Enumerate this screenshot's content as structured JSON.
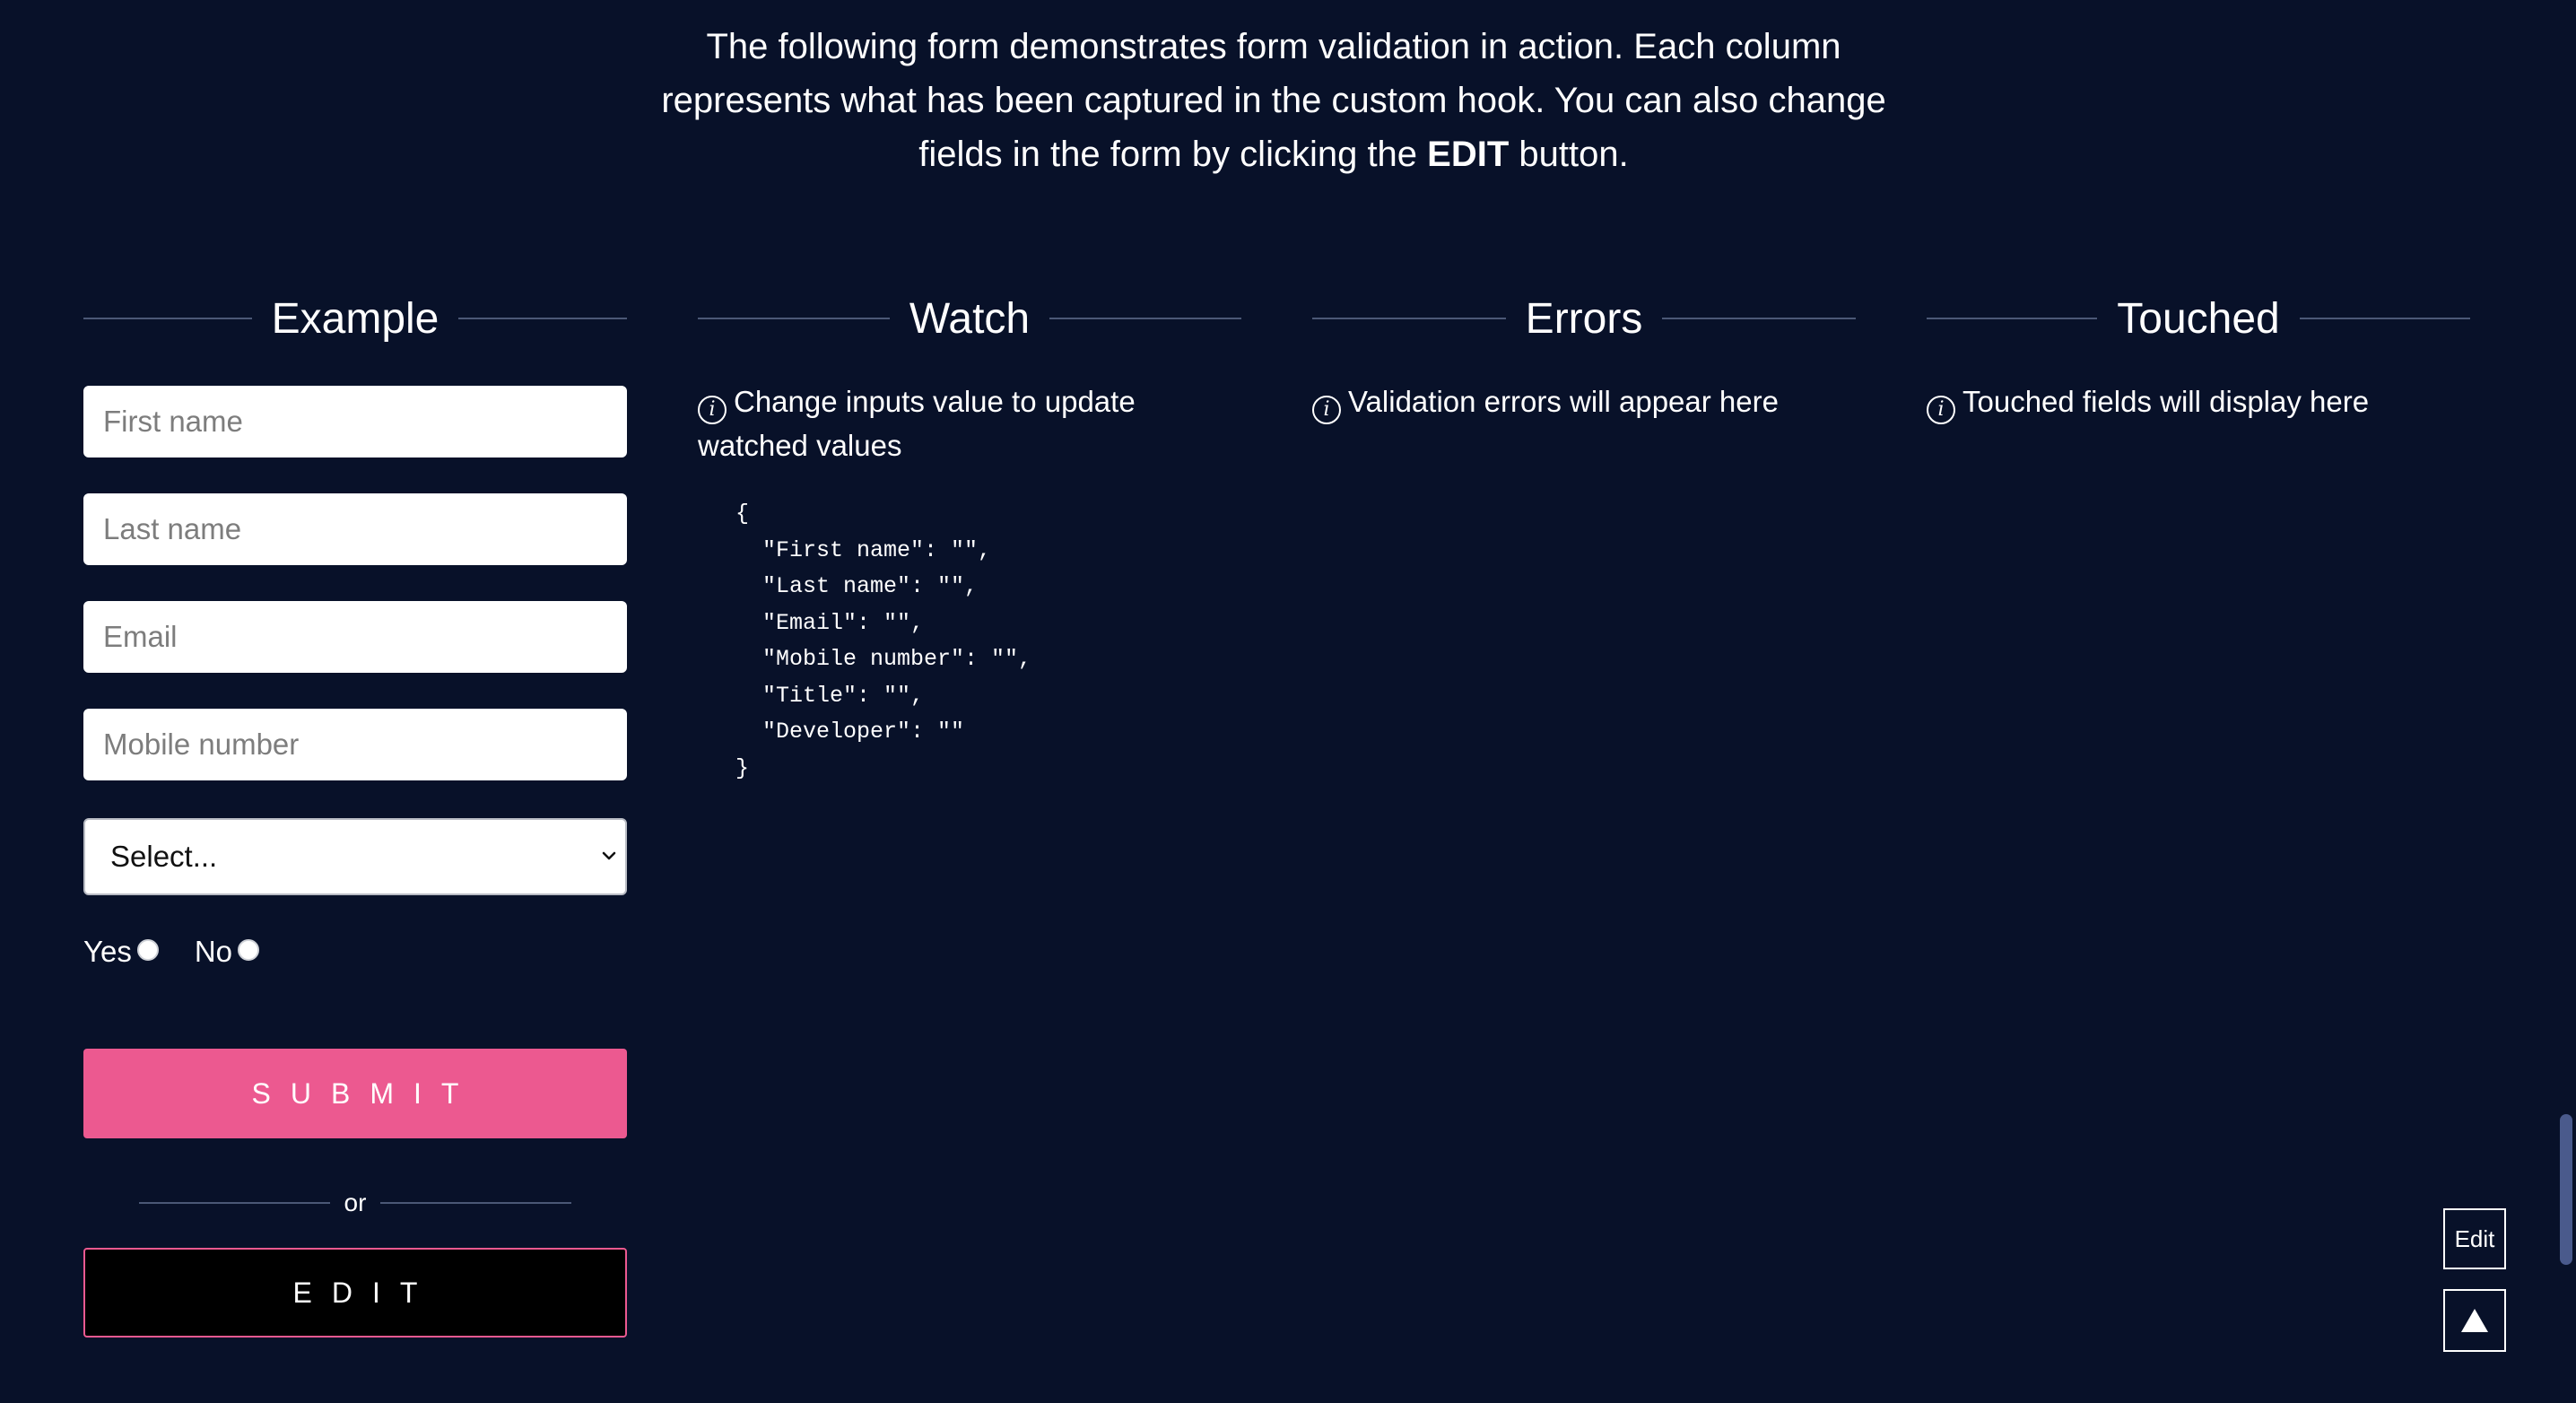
{
  "intro": {
    "line1": "The following form demonstrates form validation in action. Each column",
    "line2": "represents what has been captured in the custom hook. You can also change",
    "line3_before": "fields in the form by clicking the ",
    "line3_bold": "EDIT",
    "line3_after": " button."
  },
  "columns": {
    "example": {
      "title": "Example"
    },
    "watch": {
      "title": "Watch",
      "info": "Change inputs value to update watched values",
      "code": "{\n  \"First name\": \"\",\n  \"Last name\": \"\",\n  \"Email\": \"\",\n  \"Mobile number\": \"\",\n  \"Title\": \"\",\n  \"Developer\": \"\"\n}"
    },
    "errors": {
      "title": "Errors",
      "info": "Validation errors will appear here"
    },
    "touched": {
      "title": "Touched",
      "info": "Touched fields will display here"
    }
  },
  "form": {
    "first_name": {
      "placeholder": "First name",
      "value": ""
    },
    "last_name": {
      "placeholder": "Last name",
      "value": ""
    },
    "email": {
      "placeholder": "Email",
      "value": ""
    },
    "mobile": {
      "placeholder": "Mobile number",
      "value": ""
    },
    "title_select": {
      "selected": "Select..."
    },
    "developer": {
      "yes_label": "Yes",
      "no_label": "No"
    },
    "submit_label": "SUBMIT",
    "or_label": "or",
    "edit_label": "EDIT"
  },
  "floating": {
    "edit_label": "Edit",
    "scroll_top_icon": "triangle-up-icon"
  },
  "colors": {
    "background": "#081129",
    "accent": "#ec5990",
    "divider": "#4b5876"
  }
}
